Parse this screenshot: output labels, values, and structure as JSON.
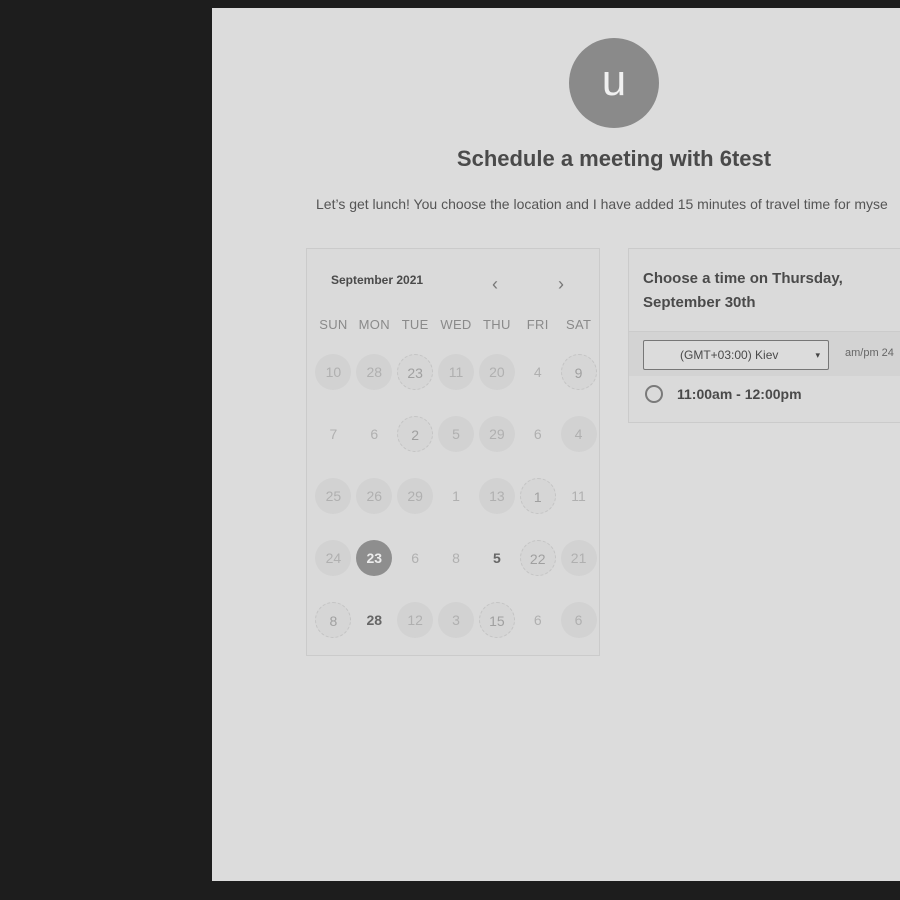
{
  "avatar": {
    "initial": "u"
  },
  "title": "Schedule a meeting with 6test",
  "description": "Let’s get lunch! You choose the location and I have added 15 minutes of travel time for myse",
  "calendar": {
    "month": "September 2021",
    "prev_icon": "‹",
    "next_icon": "›",
    "weekdays": [
      "SUN",
      "MON",
      "TUE",
      "WED",
      "THU",
      "FRI",
      "SAT"
    ],
    "weeks": [
      [
        {
          "d": "10",
          "s": "normal"
        },
        {
          "d": "28",
          "s": "normal"
        },
        {
          "d": "23",
          "s": "avail"
        },
        {
          "d": "11",
          "s": "normal"
        },
        {
          "d": "20",
          "s": "normal"
        },
        {
          "d": "4",
          "s": "plain"
        },
        {
          "d": "9",
          "s": "avail"
        }
      ],
      [
        {
          "d": "7",
          "s": "plain"
        },
        {
          "d": "6",
          "s": "plain"
        },
        {
          "d": "2",
          "s": "avail"
        },
        {
          "d": "5",
          "s": "normal"
        },
        {
          "d": "29",
          "s": "normal"
        },
        {
          "d": "6",
          "s": "plain"
        },
        {
          "d": "4",
          "s": "normal"
        }
      ],
      [
        {
          "d": "25",
          "s": "normal"
        },
        {
          "d": "26",
          "s": "normal"
        },
        {
          "d": "29",
          "s": "normal"
        },
        {
          "d": "1",
          "s": "plain"
        },
        {
          "d": "13",
          "s": "normal"
        },
        {
          "d": "1",
          "s": "avail"
        },
        {
          "d": "11",
          "s": "plain"
        }
      ],
      [
        {
          "d": "24",
          "s": "normal"
        },
        {
          "d": "23",
          "s": "selected"
        },
        {
          "d": "6",
          "s": "plain"
        },
        {
          "d": "8",
          "s": "plain"
        },
        {
          "d": "5",
          "s": "dark"
        },
        {
          "d": "22",
          "s": "avail"
        },
        {
          "d": "21",
          "s": "normal"
        }
      ],
      [
        {
          "d": "8",
          "s": "avail"
        },
        {
          "d": "28",
          "s": "dark"
        },
        {
          "d": "12",
          "s": "normal"
        },
        {
          "d": "3",
          "s": "normal"
        },
        {
          "d": "15",
          "s": "avail"
        },
        {
          "d": "6",
          "s": "plain"
        },
        {
          "d": "6",
          "s": "normal"
        }
      ]
    ]
  },
  "time_panel": {
    "heading": "Choose a time on Thursday, September 30th",
    "timezone": "(GMT+03:00) Kiev",
    "caret_icon": "▾",
    "format_toggle": "am/pm 24",
    "slots": [
      "11:00am - 12:00pm"
    ]
  },
  "colors": {
    "background": "#1d1d1d",
    "page": "#dcdcdc",
    "selected_day": "#8e8e8e"
  }
}
